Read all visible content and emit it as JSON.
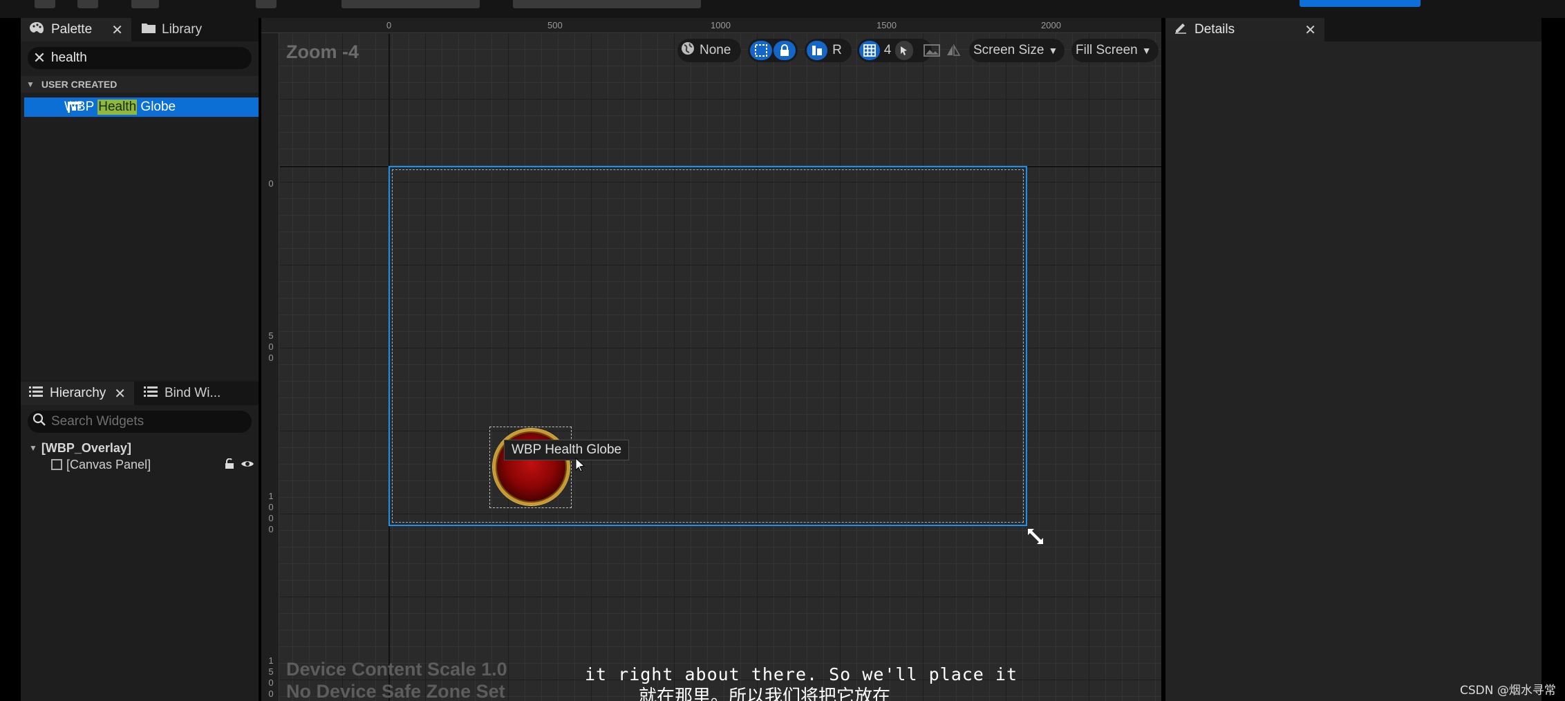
{
  "palette": {
    "tab_label": "Palette",
    "library_tab_label": "Library",
    "search_value": "health",
    "section_header": "USER CREATED",
    "item_prefix": "WBP ",
    "item_highlight": "Health",
    "item_suffix": " Globe"
  },
  "hierarchy": {
    "tab_label": "Hierarchy",
    "bind_tab_label": "Bind Wi...",
    "search_placeholder": "Search Widgets",
    "root": "[WBP_Overlay]",
    "child": "[Canvas Panel]"
  },
  "designer": {
    "zoom": "Zoom -4",
    "ruler_top": [
      "0",
      "500",
      "1000",
      "1500",
      "2000"
    ],
    "ruler_left": [
      "0",
      "500",
      "1000",
      "1500"
    ],
    "toolbar": {
      "localization": "None",
      "r_button": "R",
      "grid_snap": "4",
      "screen_size": "Screen Size",
      "fill_screen": "Fill Screen"
    },
    "device_scale_line1": "Device Content Scale 1.0",
    "device_scale_line2": "No Device Safe Zone Set",
    "tooltip": "WBP Health Globe"
  },
  "details": {
    "tab_label": "Details"
  },
  "subtitle": {
    "en": "it right about there. So we'll place it",
    "zh": "就在那里。所以我们将把它放在"
  },
  "watermark": "CSDN @烟水寻常",
  "colors": {
    "accent": "#0e6fd8",
    "canvas_border": "#1e90e8",
    "highlight": "#8fb83c"
  }
}
